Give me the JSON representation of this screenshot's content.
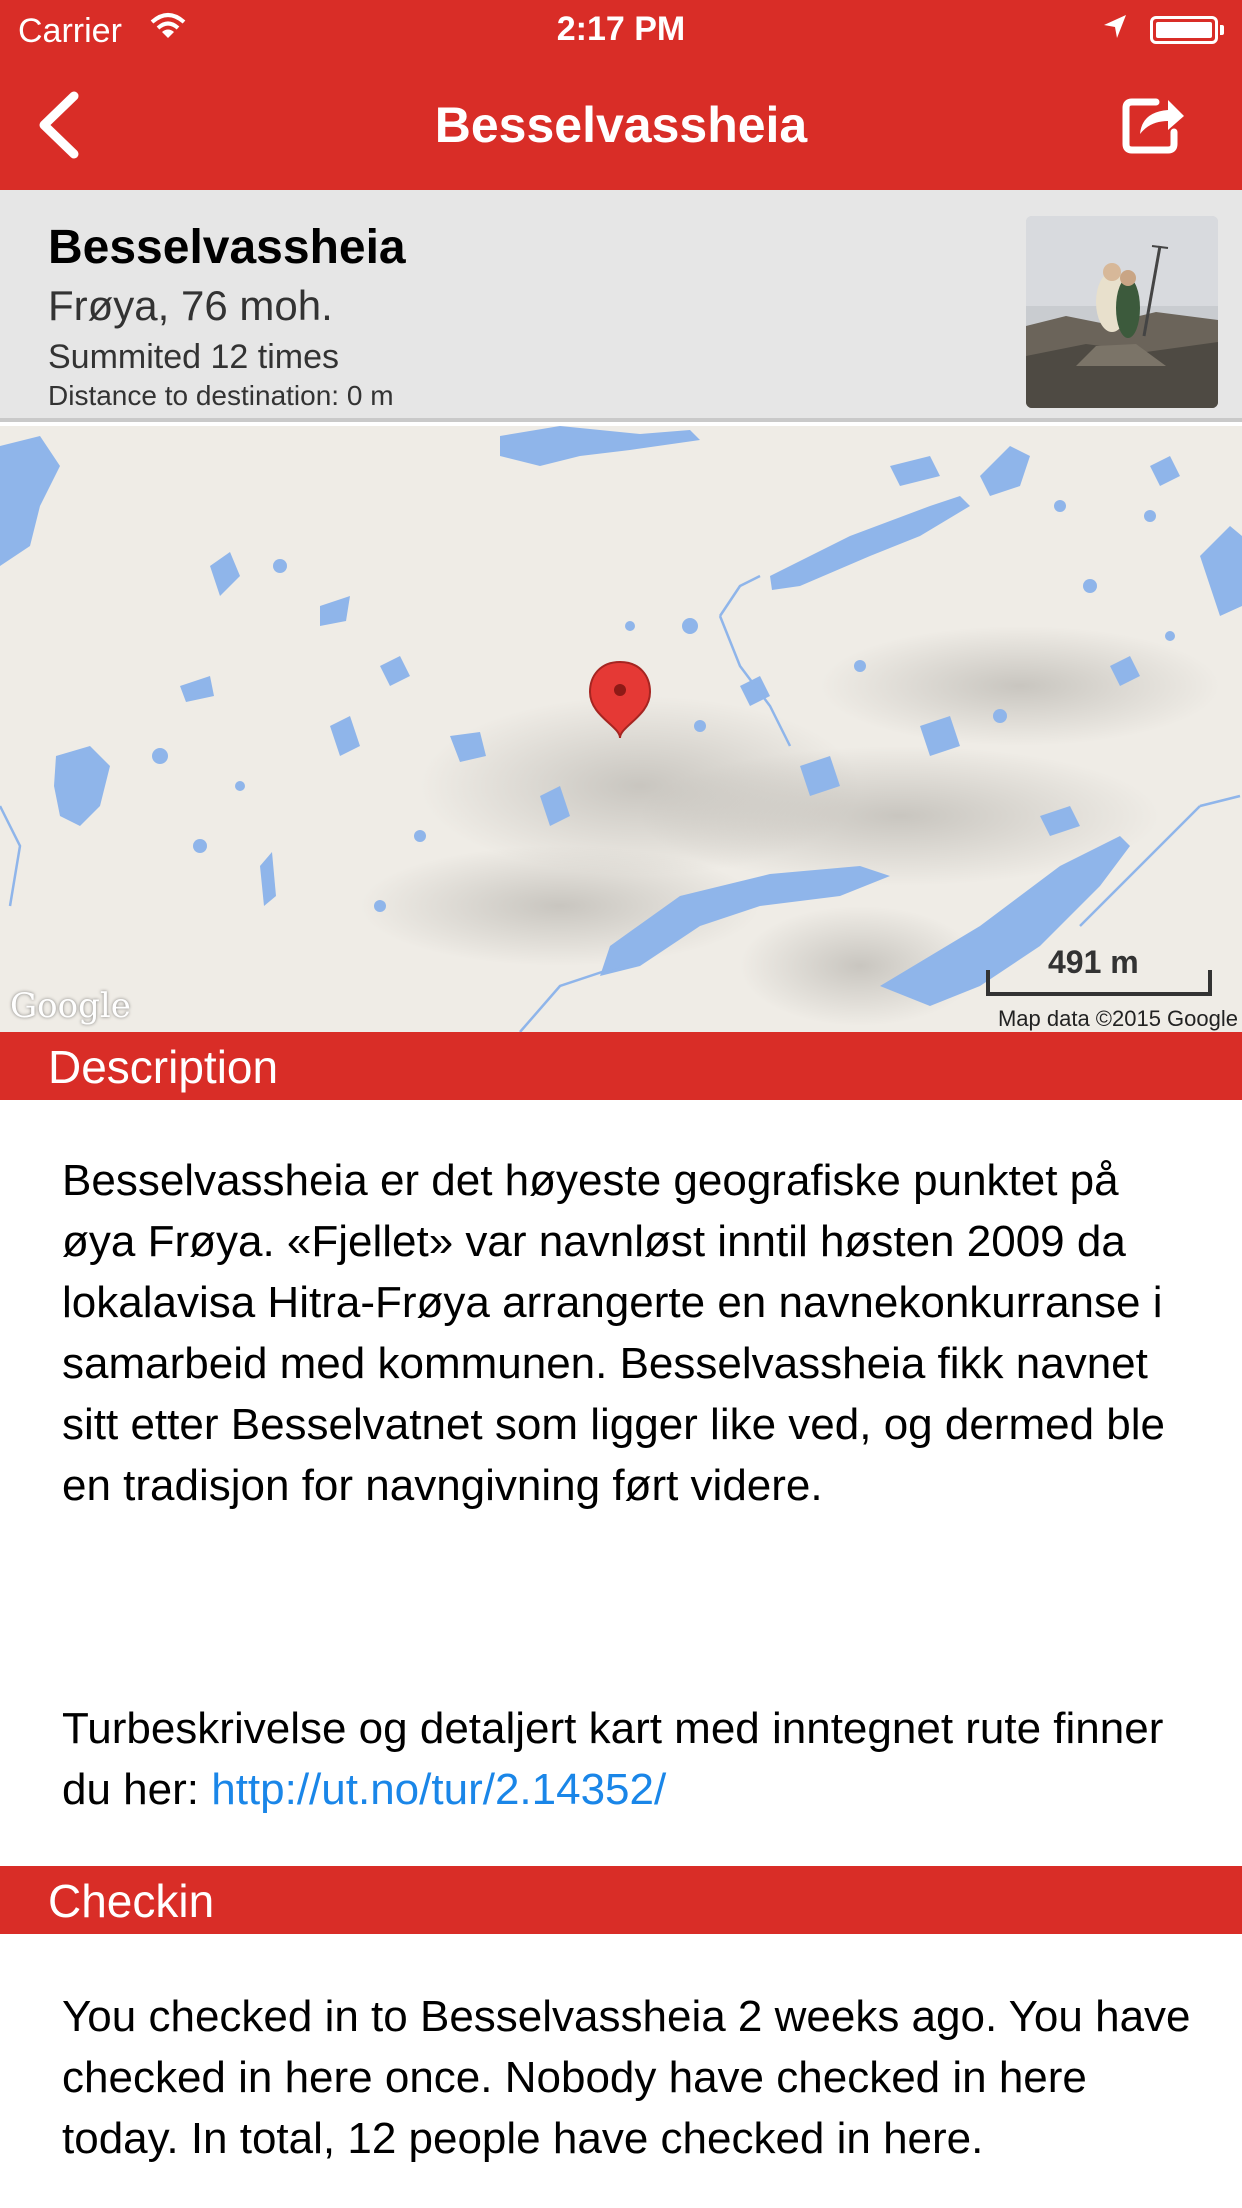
{
  "status_bar": {
    "carrier": "Carrier",
    "time": "2:17 PM"
  },
  "nav": {
    "title": "Besselvassheia"
  },
  "summary": {
    "name": "Besselvassheia",
    "location": "Frøya, 76 moh.",
    "summited": "Summited 12 times",
    "distance": "Distance to destination: 0 m"
  },
  "map": {
    "scale_label": "491 m",
    "attribution": "Map data ©2015 Google",
    "logo": "Google"
  },
  "description": {
    "header": "Description",
    "paragraph1": "Besselvassheia er det høyeste geografiske punktet på øya Frøya. «Fjellet» var navnløst inntil høsten 2009 da lokalavisa Hitra-Frøya arrangerte en navnekonkurranse i samarbeid med kommunen. Besselvassheia fikk navnet sitt etter Besselvatnet som ligger like ved, og dermed ble en tradisjon for navngivning ført videre.",
    "paragraph2_prefix": "Turbeskrivelse og detaljert kart med inntegnet rute finner du her: ",
    "link": "http://ut.no/tur/2.14352/"
  },
  "checkin": {
    "header": "Checkin",
    "text": "You checked in to Besselvassheia 2 weeks ago. You have checked in here once. Nobody have checked in here today. In total, 12 people have checked in here."
  },
  "colors": {
    "accent": "#d92d27",
    "link": "#1a86e8",
    "water": "#8fb5ea",
    "land": "#efece6"
  }
}
